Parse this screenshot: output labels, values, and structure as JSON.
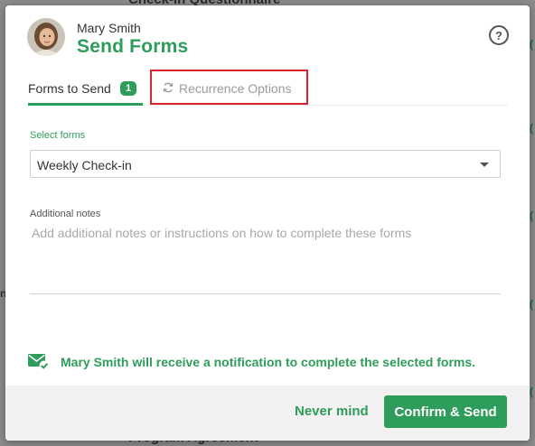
{
  "background": {
    "top_text": "Check-In Questionnaire",
    "bottom_text": "Program Agreement"
  },
  "header": {
    "user_name": "Mary Smith",
    "title": "Send Forms",
    "help_icon": "question-circle-icon"
  },
  "tabs": [
    {
      "label": "Forms to Send",
      "badge": "1",
      "active": true
    },
    {
      "label": "Recurrence Options",
      "icon": "refresh-icon",
      "active": false,
      "highlighted": true
    }
  ],
  "form": {
    "select_label": "Select forms",
    "selected_value": "Weekly Check-in",
    "notes_label": "Additional notes",
    "notes_placeholder": "Add additional notes or instructions on how to complete these forms",
    "notes_value": ""
  },
  "notification": {
    "icon": "mail-check-icon",
    "text": "Mary Smith will receive a notification to complete the selected forms."
  },
  "footer": {
    "cancel_label": "Never mind",
    "confirm_label": "Confirm & Send"
  },
  "colors": {
    "accent": "#2e9c5a",
    "highlight_box": "#d9232d",
    "footer_bg": "#f2f2f2"
  }
}
